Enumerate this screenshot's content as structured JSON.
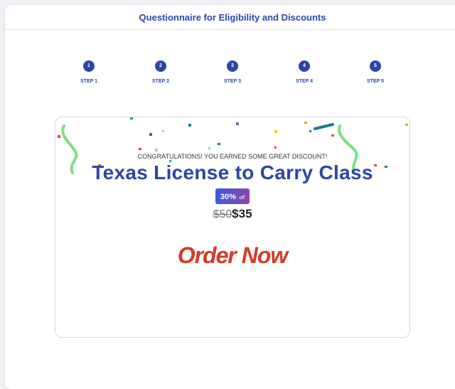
{
  "header": {
    "title": "Questionnaire for Eligibility and Discounts"
  },
  "steps": [
    {
      "number": "1",
      "label": "STEP 1"
    },
    {
      "number": "2",
      "label": "STEP 2"
    },
    {
      "number": "3",
      "label": "STEP 3"
    },
    {
      "number": "4",
      "label": "STEP 4"
    },
    {
      "number": "5",
      "label": "STEP 5"
    }
  ],
  "promo": {
    "congrats_text": "CONGRATULATIONS! YOU EARNED SOME GREAT DISCOUNT!",
    "course_title": "Texas License to Carry Class",
    "discount_percent": "30%",
    "discount_suffix": "off",
    "old_price": "$50",
    "new_price": "$35",
    "order_button": "Order Now"
  },
  "colors": {
    "primary": "#2c46a8",
    "order_button": "#d63b25",
    "badge_gradient_start": "#3b5bdb",
    "badge_gradient_end": "#8e44ad"
  }
}
